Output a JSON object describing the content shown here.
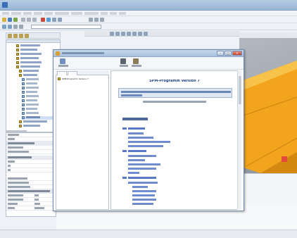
{
  "help_window": {
    "doc_title": "SPM-Programm Version 7",
    "toc_tree_root": "SPM-Programm Version 7"
  },
  "colors": {
    "accent": "#1f3f86",
    "title_bar": "#a8c1df",
    "view_orange": "#f0a020"
  }
}
